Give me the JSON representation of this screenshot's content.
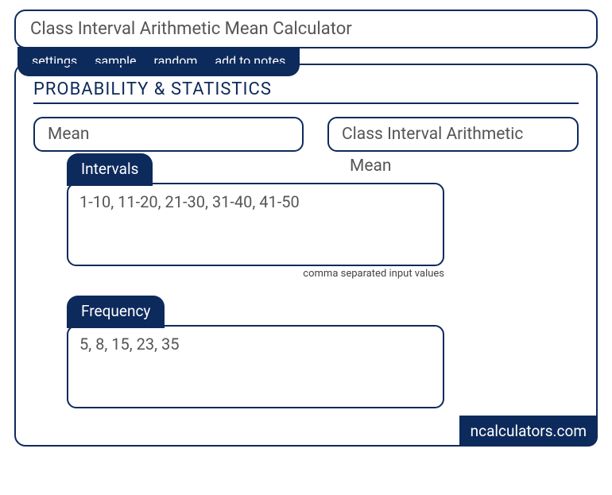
{
  "header": {
    "title": "Class Interval Arithmetic Mean Calculator"
  },
  "tabs": {
    "settings": "settings",
    "sample": "sample",
    "random": "random",
    "notes": "add to notes"
  },
  "section": {
    "title": "PROBABILITY & STATISTICS"
  },
  "pills": {
    "left": "Mean",
    "right": "Class Interval Arithmetic",
    "right_extra": "Mean"
  },
  "intervals": {
    "label": "Intervals",
    "value": "1-10, 11-20, 21-30, 31-40, 41-50",
    "hint": "comma separated input values"
  },
  "frequency": {
    "label": "Frequency",
    "value": "5, 8, 15, 23, 35"
  },
  "brand": "ncalculators.com"
}
